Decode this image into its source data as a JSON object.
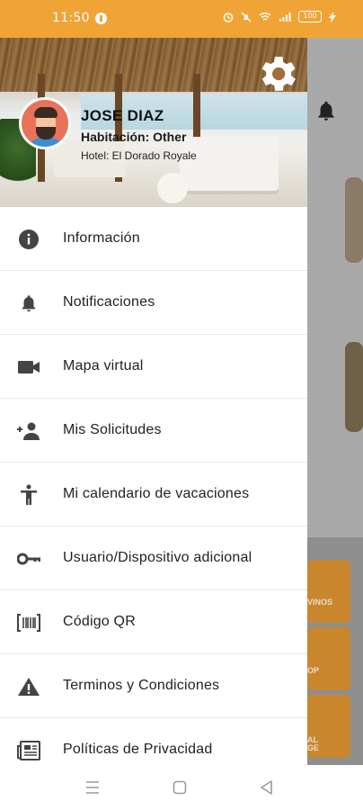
{
  "status_bar": {
    "time": "11:50",
    "battery": "100",
    "app_icon": "info-circle-icon"
  },
  "user": {
    "name": "JOSE DIAZ",
    "room": "Habitación: Other",
    "hotel": "Hotel: El Dorado Royale"
  },
  "menu": [
    {
      "label": "Información",
      "icon": "info-icon"
    },
    {
      "label": "Notificaciones",
      "icon": "bell-icon"
    },
    {
      "label": "Mapa virtual",
      "icon": "video-camera-icon"
    },
    {
      "label": "Mis Solicitudes",
      "icon": "person-add-icon"
    },
    {
      "label": "Mi calendario de vacaciones",
      "icon": "accessibility-icon"
    },
    {
      "label": "Usuario/Dispositivo adicional",
      "icon": "key-icon"
    },
    {
      "label": "Código QR",
      "icon": "barcode-icon"
    },
    {
      "label": "Terminos y Condiciones",
      "icon": "warning-icon"
    },
    {
      "label": "Políticas de Privacidad",
      "icon": "newspaper-icon"
    }
  ],
  "background": {
    "tile_1": "VINOS",
    "tile_2": "OP",
    "tile_3": "AL\nGE"
  },
  "colors": {
    "status_bar": "#f0a436",
    "accent_orange": "#c9862d",
    "drawer_bg": "#ffffff"
  }
}
